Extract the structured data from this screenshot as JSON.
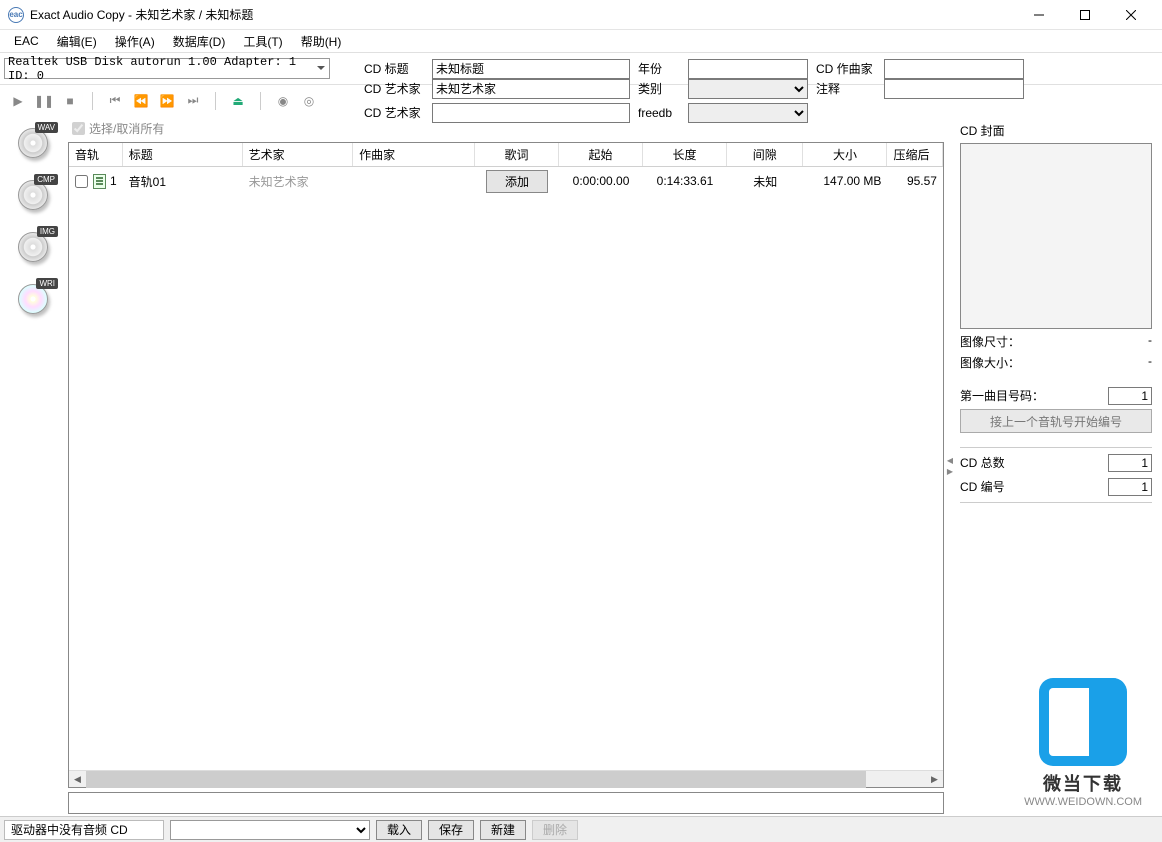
{
  "title": "Exact Audio Copy   -   未知艺术家 / 未知标题",
  "menubar": [
    "EAC",
    "编辑(E)",
    "操作(A)",
    "数据库(D)",
    "工具(T)",
    "帮助(H)"
  ],
  "drive": "Realtek USB Disk autorun 1.00   Adapter: 1  ID: 0",
  "meta": {
    "title_label": "CD 标题",
    "title_value": "未知标题",
    "artist_label": "CD 艺术家",
    "artist_value": "未知艺术家",
    "artist2_label": "CD 艺术家",
    "artist2_value": "",
    "year_label": "年份",
    "year_value": "",
    "genre_label": "类别",
    "genre_value": "",
    "freedb_label": "freedb",
    "freedb_value": "",
    "composer_label": "CD 作曲家",
    "composer_value": "",
    "comment_label": "注释",
    "comment_value": ""
  },
  "select_all": "选择/取消所有",
  "rail": {
    "wav": "WAV",
    "cmp": "CMP",
    "img": "IMG",
    "wri": "WRI"
  },
  "columns": {
    "track": "音轨",
    "title": "标题",
    "artist": "艺术家",
    "composer": "作曲家",
    "lyric": "歌词",
    "start": "起始",
    "length": "长度",
    "gap": "间隙",
    "size": "大小",
    "compressed": "压缩后"
  },
  "rows": [
    {
      "num": "1",
      "title": "音轨01",
      "artist": "未知艺术家",
      "composer": "",
      "lyric_btn": "添加",
      "start": "0:00:00.00",
      "length": "0:14:33.61",
      "gap": "未知",
      "size": "147.00 MB",
      "compressed": "95.57"
    }
  ],
  "right": {
    "cover_label": "CD 封面",
    "img_dim_label": "图像尺寸：",
    "img_dim_value": "-",
    "img_size_label": "图像大小：",
    "img_size_value": "-",
    "first_track_label": "第一曲目号码：",
    "first_track_value": "1",
    "continue_btn": "接上一个音轨号开始编号",
    "cd_total_label": "CD 总数",
    "cd_total_value": "1",
    "cd_index_label": "CD 编号",
    "cd_index_value": "1"
  },
  "status": {
    "drive_msg": "驱动器中没有音频 CD",
    "load": "载入",
    "save": "保存",
    "new": "新建",
    "delete": "删除"
  },
  "watermark": {
    "cn": "微当下载",
    "url": "WWW.WEIDOWN.COM"
  }
}
